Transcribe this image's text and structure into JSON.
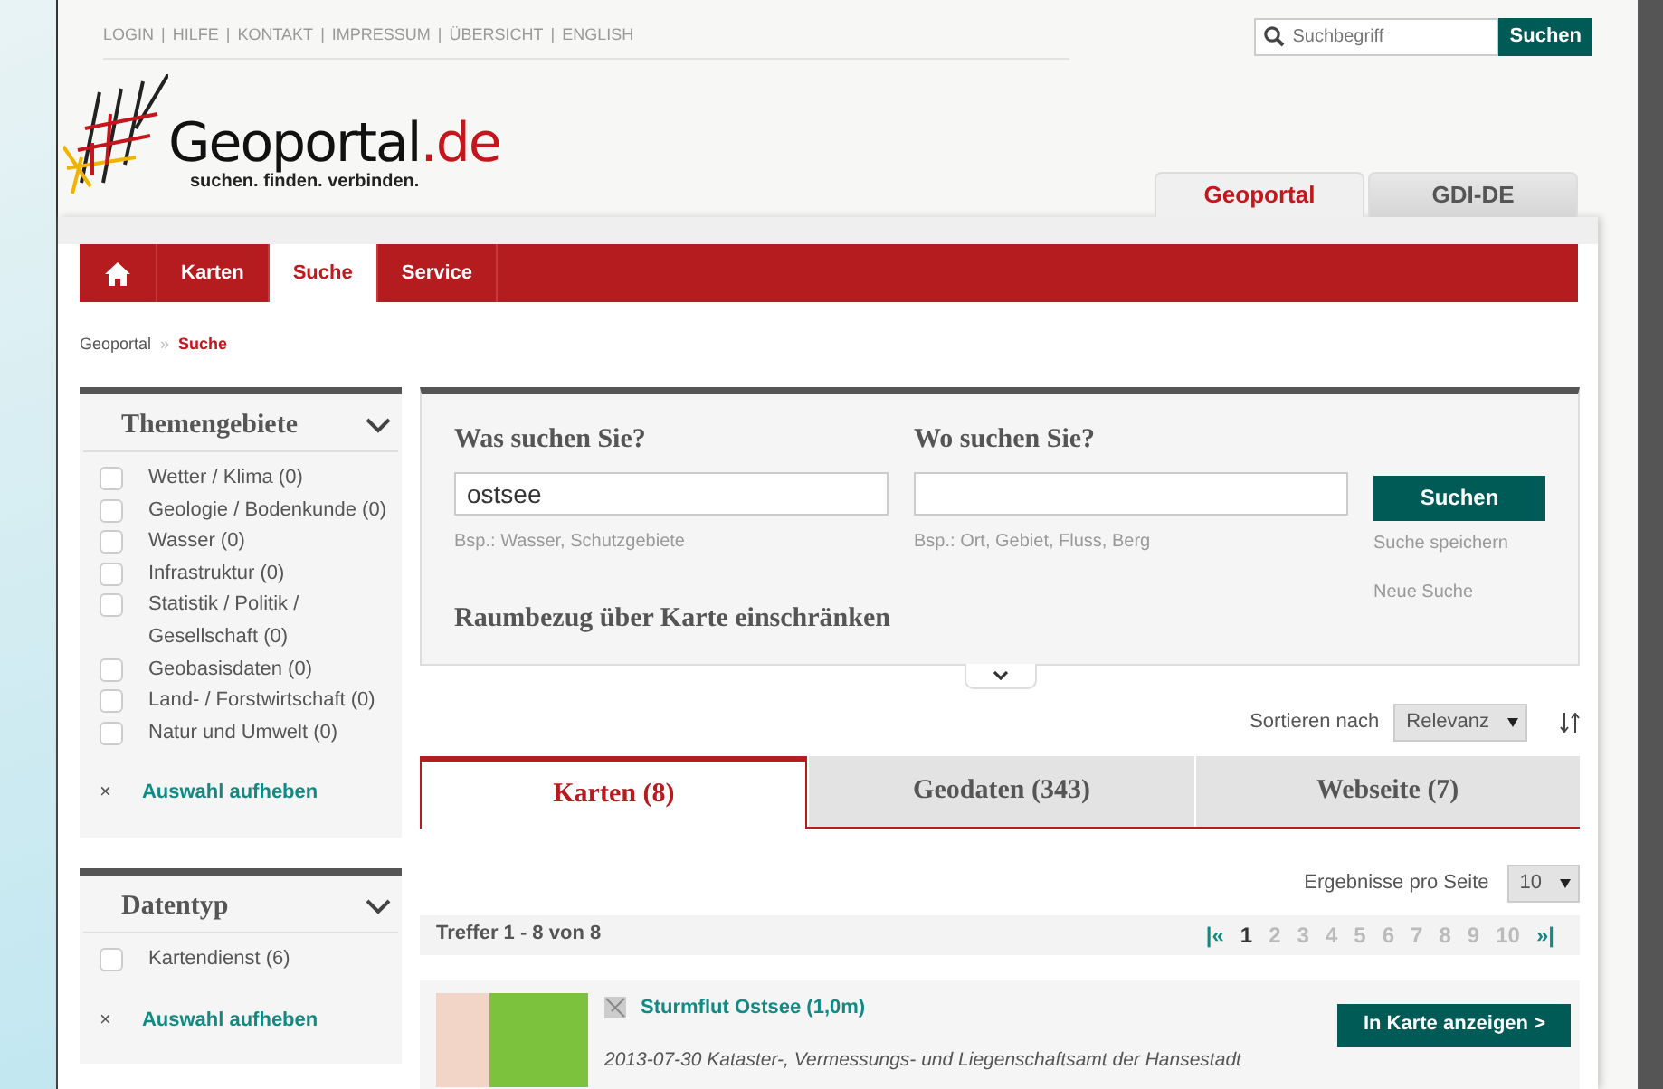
{
  "top_links": [
    {
      "label": "LOGIN"
    },
    {
      "label": "HILFE"
    },
    {
      "label": "KONTAKT"
    },
    {
      "label": "IMPRESSUM"
    },
    {
      "label": "ÜBERSICHT"
    },
    {
      "label": "ENGLISH"
    }
  ],
  "top_link_separator": "|",
  "header_search": {
    "placeholder": "Suchbegriff",
    "button": "Suchen"
  },
  "logo": {
    "name": "Geoportal",
    "suffix": ".de",
    "slogan": "suchen. finden. verbinden."
  },
  "site_tabs": [
    {
      "label": "Geoportal",
      "selected": true
    },
    {
      "label": "GDI-DE",
      "selected": false
    }
  ],
  "nav": [
    {
      "kind": "home",
      "selected": false
    },
    {
      "kind": "text",
      "label": "Karten",
      "selected": false
    },
    {
      "kind": "text",
      "label": "Suche",
      "selected": true
    },
    {
      "kind": "text",
      "label": "Service",
      "selected": false
    }
  ],
  "breadcrumb": {
    "items": [
      "Geoportal",
      "Suche"
    ],
    "separator": "»"
  },
  "sidebar": [
    {
      "title": "Themengebiete",
      "options": [
        {
          "label": "Wetter / Klima (0)",
          "checked": false
        },
        {
          "label": "Geologie / Bodenkunde (0)",
          "checked": false
        },
        {
          "label": "Wasser (0)",
          "checked": false
        },
        {
          "label": "Infrastruktur (0)",
          "checked": false
        },
        {
          "label": "Statistik / Politik / Gesellschaft (0)",
          "checked": false
        },
        {
          "label": "Geobasisdaten (0)",
          "checked": false
        },
        {
          "label": "Land- / Forstwirtschaft (0)",
          "checked": false
        },
        {
          "label": "Natur und Umwelt (0)",
          "checked": false
        }
      ],
      "clear_icon": "×",
      "clear_label": "Auswahl aufheben"
    },
    {
      "title": "Datentyp",
      "options": [
        {
          "label": "Kartendienst (6)",
          "checked": false
        }
      ],
      "clear_icon": "×",
      "clear_label": "Auswahl aufheben"
    }
  ],
  "search": {
    "what": {
      "label": "Was suchen Sie?",
      "value": "ostsee",
      "hint": "Bsp.: Wasser, Schutzgebiete"
    },
    "where": {
      "label": "Wo suchen Sie?",
      "hint": "Bsp.: Ort, Gebiet, Fluss, Berg"
    },
    "button": "Suchen",
    "links": [
      "Suche speichern",
      "Neue Suche"
    ],
    "map_label": "Raumbezug über Karte einschränken"
  },
  "sort": {
    "label": "Sortieren nach",
    "value": "Relevanz"
  },
  "result_tabs": [
    {
      "label": "Karten (8)",
      "selected": true
    },
    {
      "label": "Geodaten (343)",
      "selected": false
    },
    {
      "label": "Webseite (7)",
      "selected": false
    }
  ],
  "per_page": {
    "label": "Ergebnisse pro Seite",
    "value": "10"
  },
  "hits": "Treffer 1 - 8 von 8",
  "pagination": {
    "first": "|«",
    "pages": [
      {
        "label": "1",
        "selected": true
      },
      {
        "label": "2",
        "selected": false
      },
      {
        "label": "3",
        "selected": false
      },
      {
        "label": "4",
        "selected": false
      },
      {
        "label": "5",
        "selected": false
      },
      {
        "label": "6",
        "selected": false
      },
      {
        "label": "7",
        "selected": false
      },
      {
        "label": "8",
        "selected": false
      },
      {
        "label": "9",
        "selected": false
      },
      {
        "label": "10",
        "selected": false
      }
    ],
    "last": "»|"
  },
  "results": [
    {
      "title": "Sturmflut Ostsee (1,0m)",
      "description": "2013-07-30 Kataster-, Vermessungs- und Liegenschaftsamt der Hansestadt",
      "button": "In Karte anzeigen >"
    }
  ]
}
